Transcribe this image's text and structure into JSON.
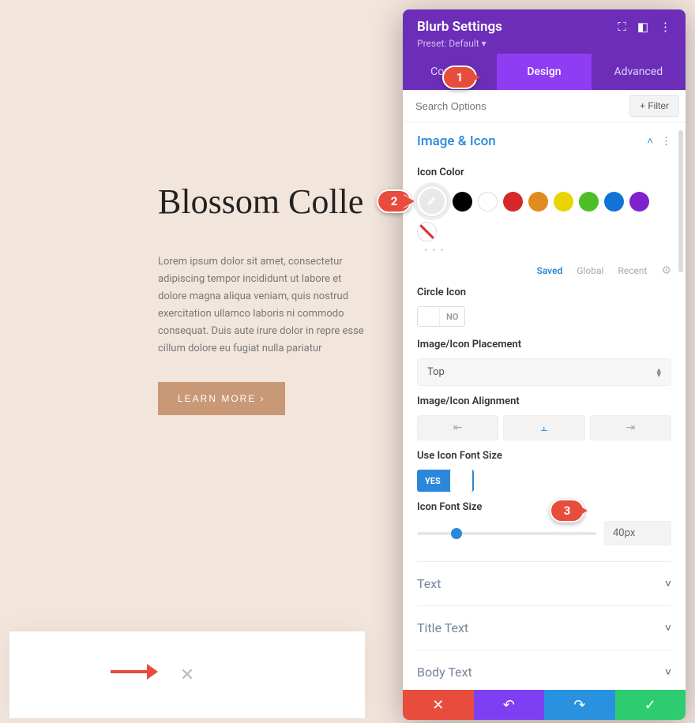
{
  "preview": {
    "heading": "Blossom Colle",
    "paragraph": "Lorem ipsum dolor sit amet, consectetur adipiscing tempor incididunt ut labore et dolore magna aliqua veniam, quis nostrud exercitation ullamco laboris ni commodo consequat. Duis aute irure dolor in repre esse cillum dolore eu fugiat nulla pariatur",
    "button": "LEARN MORE   ›",
    "close_icon": "✕"
  },
  "panel": {
    "title": "Blurb Settings",
    "preset": "Preset: Default ▾",
    "tabs": {
      "content": "Content",
      "design": "Design",
      "advanced": "Advanced"
    },
    "search_placeholder": "Search Options",
    "filter": "+  Filter",
    "section_image_icon": "Image & Icon",
    "icon_color_label": "Icon Color",
    "swatch_colors": [
      "#000000",
      "#ffffff",
      "#d62828",
      "#e08b1f",
      "#e8d400",
      "#4cbf26",
      "#1273d6",
      "#7e22ce"
    ],
    "color_tabs": {
      "saved": "Saved",
      "global": "Global",
      "recent": "Recent"
    },
    "circle_icon_label": "Circle Icon",
    "circle_icon_value": "NO",
    "placement_label": "Image/Icon Placement",
    "placement_value": "Top",
    "alignment_label": "Image/Icon Alignment",
    "use_icon_font_label": "Use Icon Font Size",
    "use_icon_font_value": "YES",
    "icon_font_size_label": "Icon Font Size",
    "icon_font_size_value": "40px",
    "collapsed": {
      "text": "Text",
      "title_text": "Title Text",
      "body_text": "Body Text"
    }
  },
  "markers": {
    "m1": "1",
    "m2": "2",
    "m3": "3"
  }
}
